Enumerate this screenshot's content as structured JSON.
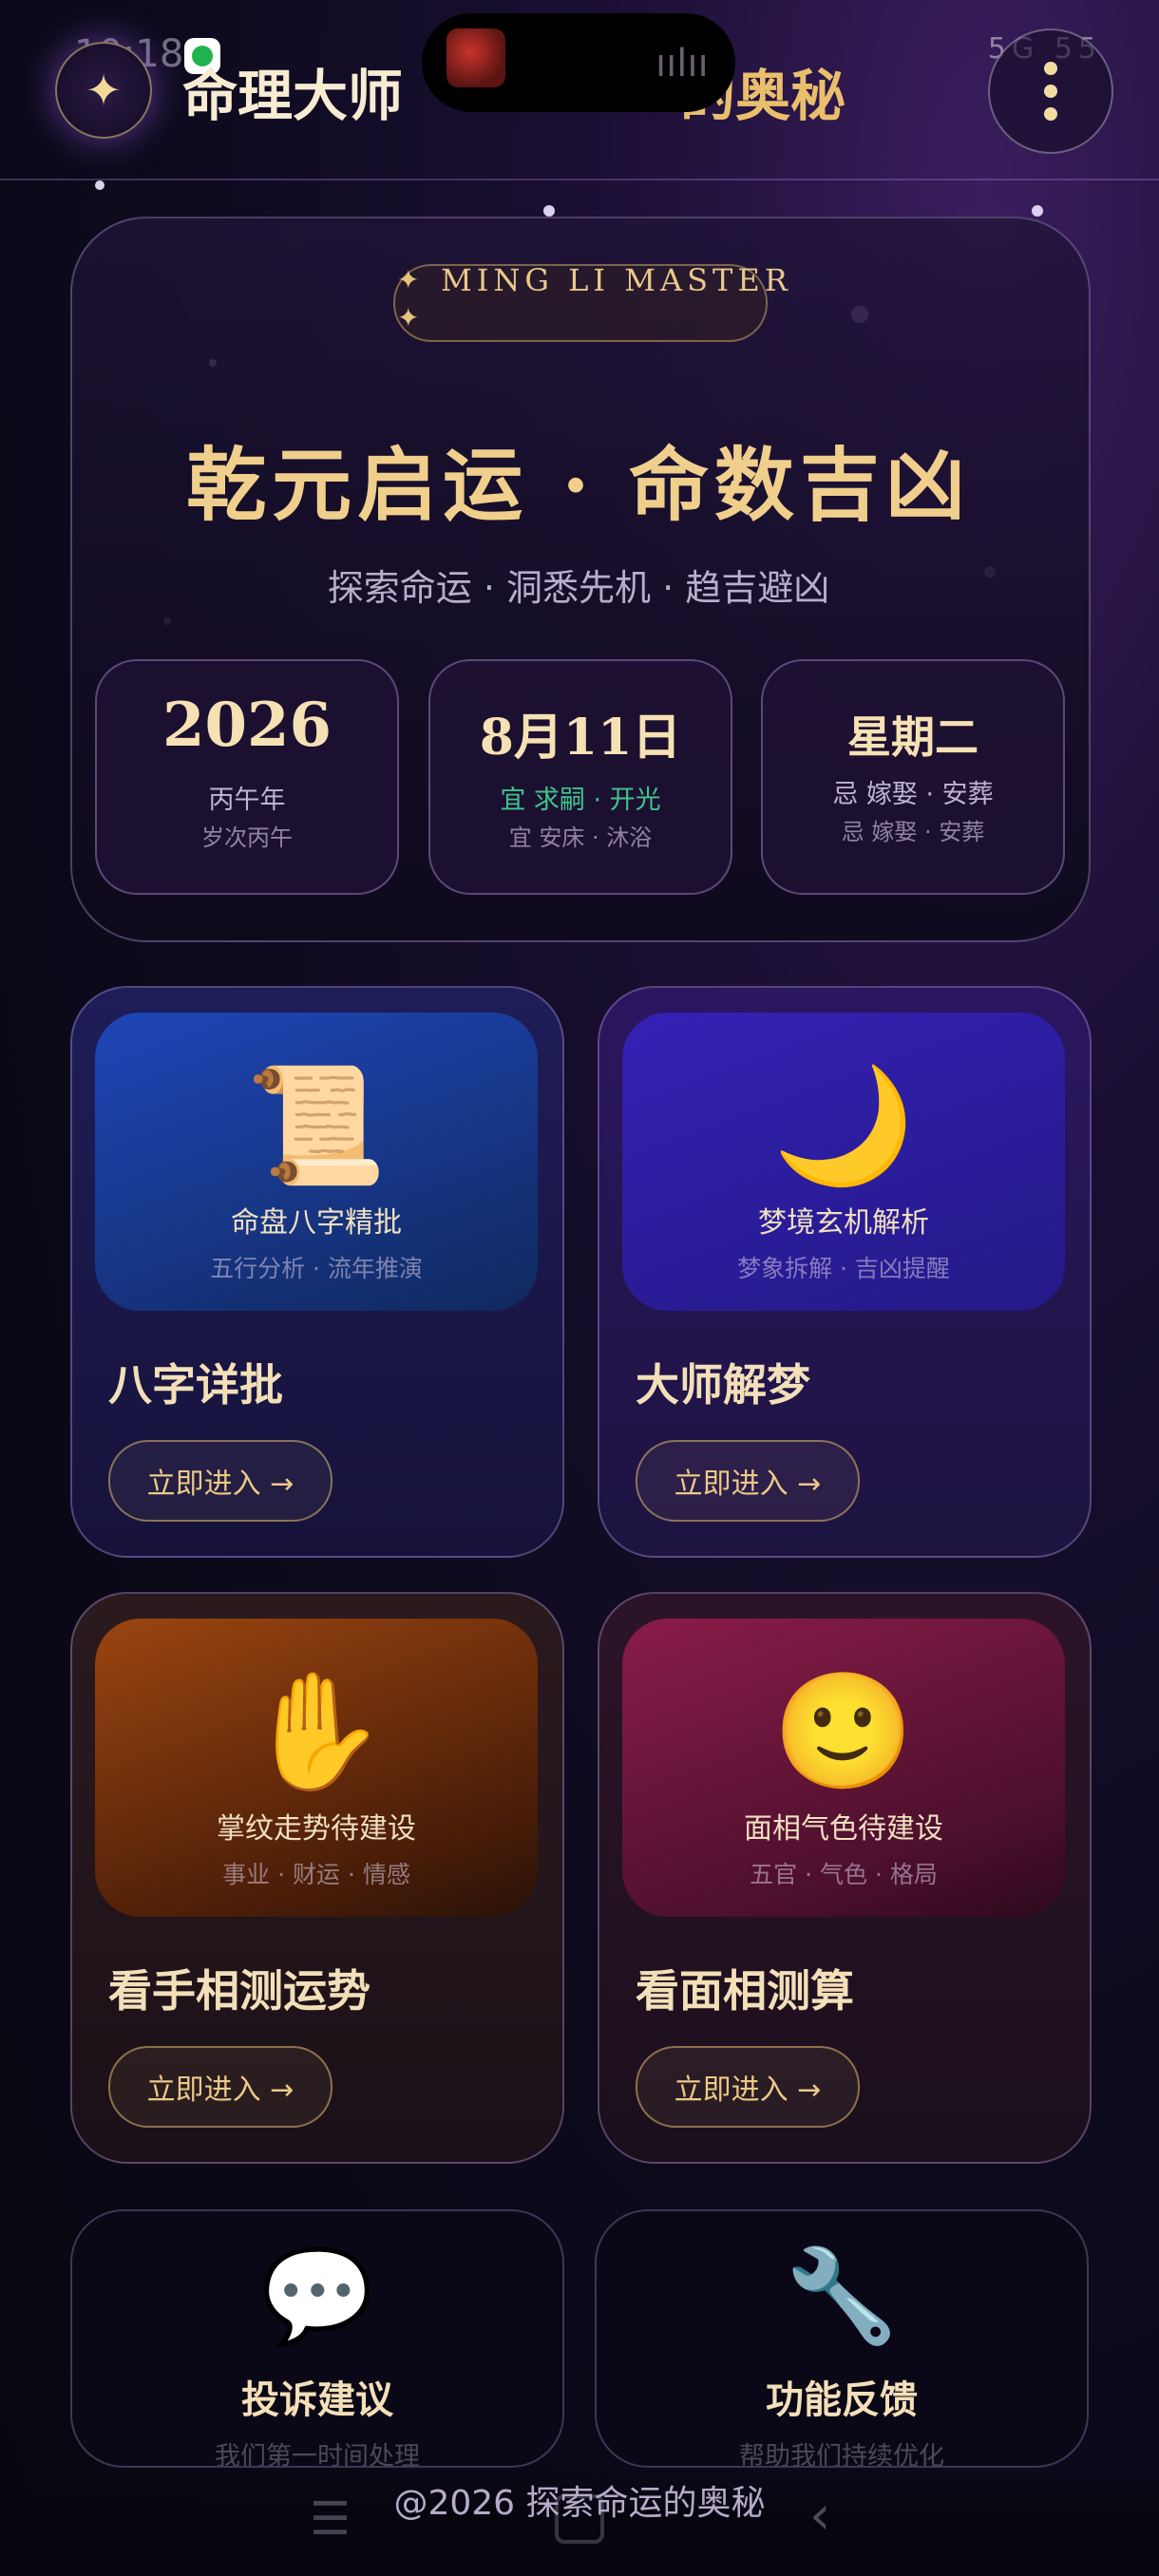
{
  "status_bar": {
    "time": "10:18",
    "right_indicators": "5G",
    "battery": "55"
  },
  "header": {
    "title_main": "命理大师",
    "title_tail": "的奥秘",
    "logo_symbol": "✦",
    "menu_icon": "vertical-dots-icon"
  },
  "hero": {
    "badge_star": "✦",
    "badge": "MING LI MASTER",
    "title": "乾元启运 · 命数吉凶",
    "subtitle": "探索命运 · 洞悉先机 · 趋吉避凶",
    "dates": [
      {
        "big": "2026",
        "line1": "丙午年",
        "line2": "岁次丙午",
        "line1_color": "#bfb4d2"
      },
      {
        "big": "8月11日",
        "line1": "宜 求嗣 · 开光",
        "line2": "宜 安床 · 沐浴",
        "line1_color": "#3fc58a"
      },
      {
        "big": "星期二",
        "line1": "忌 嫁娶 · 安葬",
        "line2": "忌 嫁娶 · 安葬",
        "line1_color": "#bfb4d2"
      }
    ]
  },
  "features": [
    {
      "icon": "scroll-icon",
      "emoji": "📜",
      "subtitle": "命盘八字精批",
      "tags": "五行分析 · 流年推演",
      "name": "八字详批",
      "button": "立即进入 →"
    },
    {
      "icon": "moon-icon",
      "emoji": "🌙",
      "subtitle": "梦境玄机解析",
      "tags": "梦象拆解 · 吉凶提醒",
      "name": "大师解梦",
      "button": "立即进入 →"
    },
    {
      "icon": "hand-icon",
      "emoji": "✋",
      "subtitle": "掌纹走势待建设",
      "tags": "事业 · 财运 · 情感",
      "name": "看手相测运势",
      "button": "立即进入 →"
    },
    {
      "icon": "smiley-icon",
      "emoji": "🙂",
      "subtitle": "面相气色待建设",
      "tags": "五官 · 气色 · 格局",
      "name": "看面相测算",
      "button": "立即进入 →"
    }
  ],
  "bottom_cards": [
    {
      "icon": "speech-bubble-icon",
      "emoji": "💬",
      "title": "投诉建议",
      "desc": "我们第一时间处理"
    },
    {
      "icon": "wrench-icon",
      "emoji": "🔧",
      "title": "功能反馈",
      "desc": "帮助我们持续优化"
    }
  ],
  "footer": {
    "text": "@2026 探索命运的奥秘"
  }
}
